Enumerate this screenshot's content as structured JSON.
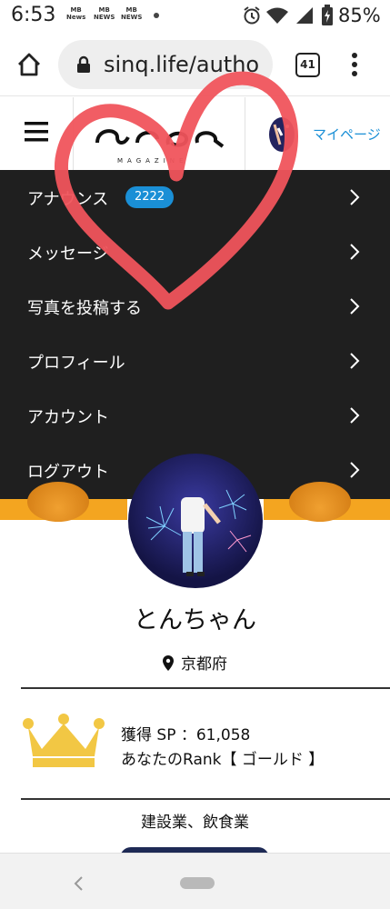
{
  "status_bar": {
    "time": "6:53",
    "notifications": [
      [
        "MB",
        "News"
      ],
      [
        "MB",
        "NEWS"
      ],
      [
        "MB",
        "NEWS"
      ]
    ],
    "battery_pct": "85%",
    "icons": [
      "alarm-icon",
      "wifi-icon",
      "signal-icon",
      "battery-icon"
    ]
  },
  "browser": {
    "url": "sinq.life/autho",
    "tab_count": "41",
    "icons": [
      "home-icon",
      "lock-icon",
      "tabs-icon",
      "more-vert-icon"
    ]
  },
  "site_header": {
    "logo_subtitle": "MAGAZINE",
    "mypage_label": "マイページ"
  },
  "menu": {
    "items": [
      {
        "label": "アナウンス",
        "badge": "2222"
      },
      {
        "label": "メッセージ"
      },
      {
        "label": "写真を投稿する"
      },
      {
        "label": "プロフィール"
      },
      {
        "label": "アカウント"
      },
      {
        "label": "ログアウト"
      }
    ]
  },
  "profile": {
    "username": "とんちゃん",
    "location": "京都府",
    "sp_text": "獲得 SP ：61,058",
    "rank_text": "あなたのRank【 ゴールド 】",
    "industry": "建設業、飲食業"
  },
  "colors": {
    "accent": "#1a8fd6",
    "menu_bg": "#1f1f1f",
    "heart": "#f0545c",
    "crown": "#f2c744"
  }
}
